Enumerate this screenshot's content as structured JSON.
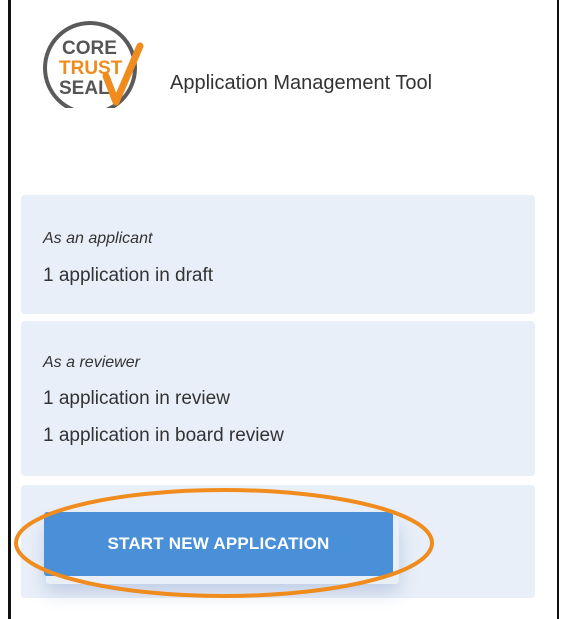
{
  "header": {
    "logo_text_lines": [
      "CORE",
      "TRUST",
      "SEAL"
    ],
    "title": "Application Management Tool"
  },
  "applicant": {
    "role_label": "As an applicant",
    "lines": [
      "1 application in draft"
    ]
  },
  "reviewer": {
    "role_label": "As a reviewer",
    "lines": [
      "1 application in review",
      "1 application in board review"
    ]
  },
  "actions": {
    "start_label": "START NEW APPLICATION"
  },
  "colors": {
    "card_background": "#e9eff8",
    "button": "#4a90d9",
    "logo_orange": "#f08c1e",
    "logo_gray": "#555555",
    "highlight": "#f08c1e"
  },
  "icons": {
    "logo": "core-trust-seal-logo",
    "highlight": "orange-highlight-ellipse"
  }
}
